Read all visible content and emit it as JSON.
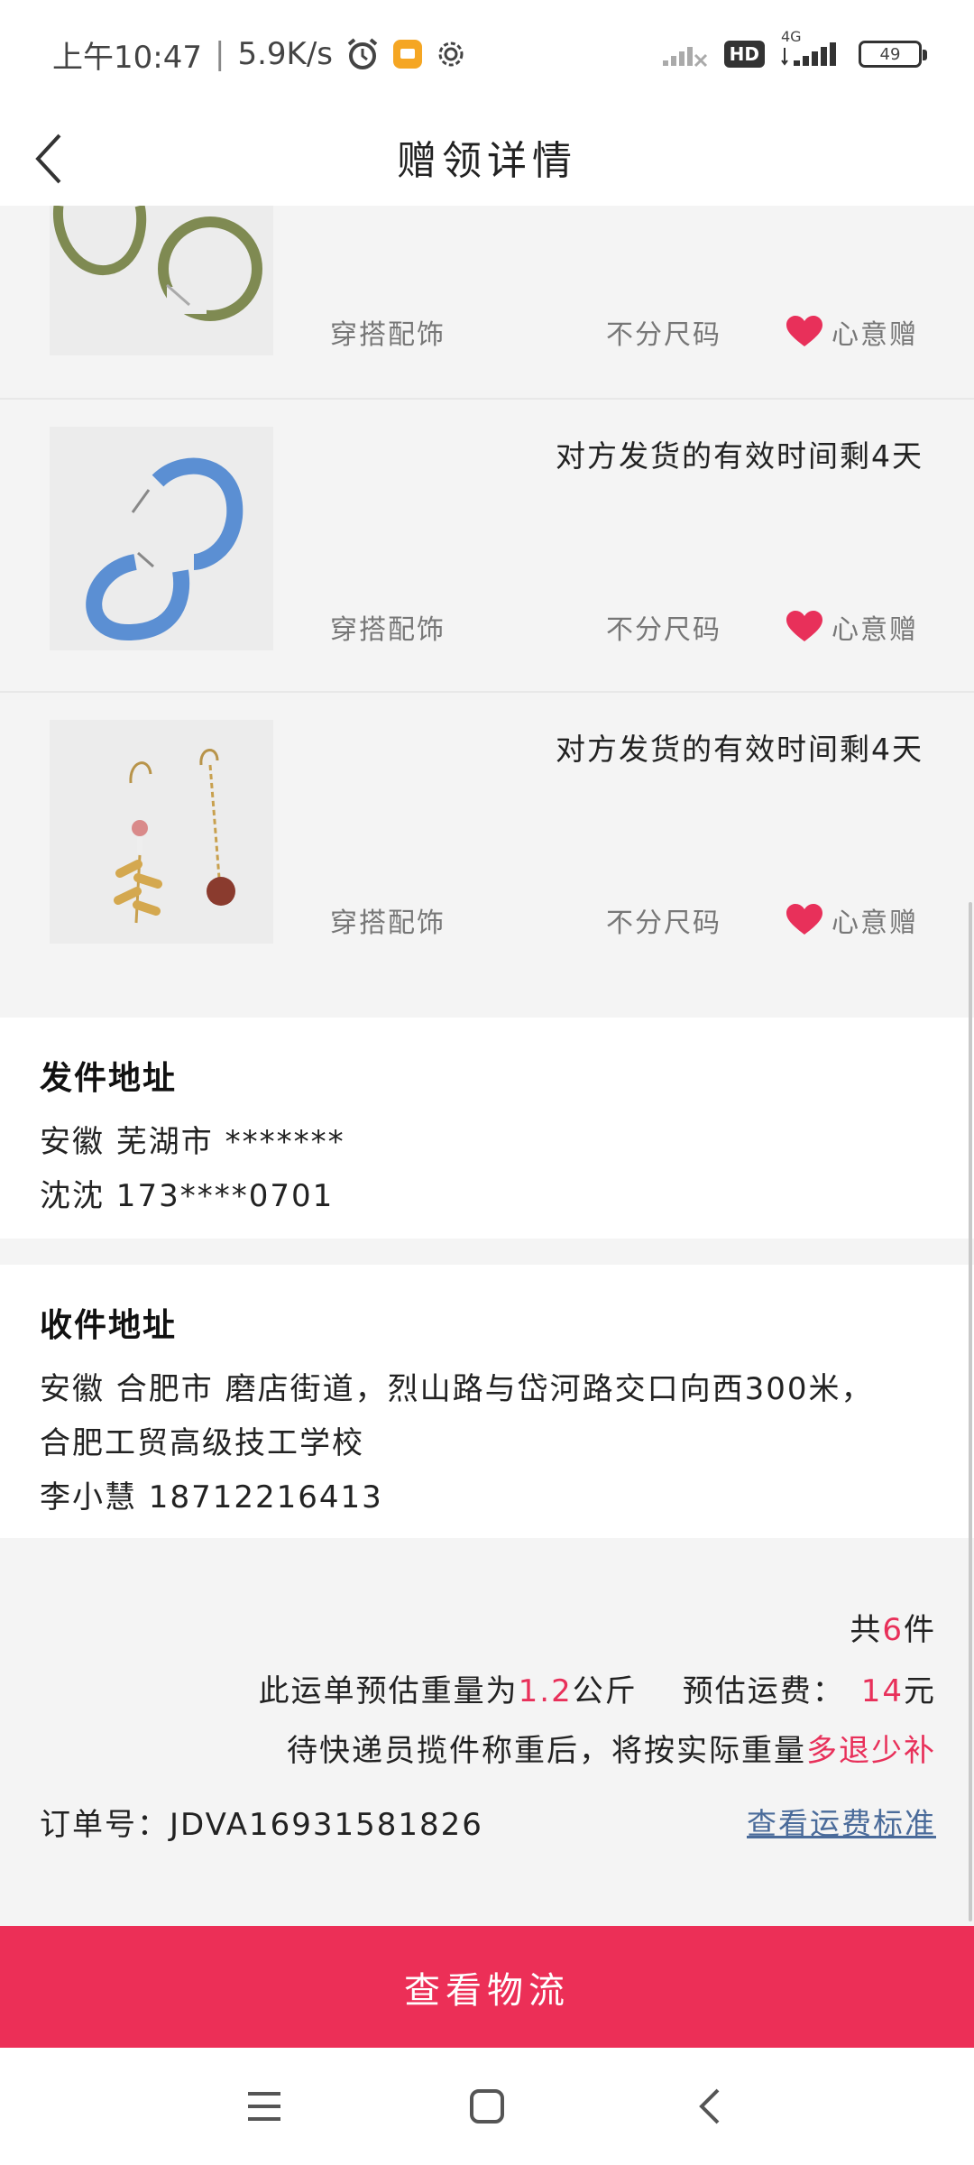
{
  "status_bar": {
    "time": "上午10:47",
    "speed": "5.9K/s",
    "hd": "HD",
    "network": "4G",
    "battery": "49"
  },
  "header": {
    "title": "赠领详情"
  },
  "items": [
    {
      "deadline": "",
      "category": "穿搭配饰",
      "size": "不分尺码",
      "type": "心意赠",
      "photo": "green-hoop-earrings"
    },
    {
      "deadline": "对方发货的有效时间剩4天",
      "category": "穿搭配饰",
      "size": "不分尺码",
      "type": "心意赠",
      "photo": "blue-hoop-earrings"
    },
    {
      "deadline": "对方发货的有效时间剩4天",
      "category": "穿搭配饰",
      "size": "不分尺码",
      "type": "心意赠",
      "photo": "leaf-bead-drop-earrings"
    }
  ],
  "sender": {
    "title": "发件地址",
    "address": "安徽 芜湖市 *******",
    "contact": "沈沈 173****0701"
  },
  "receiver": {
    "title": "收件地址",
    "address_line1": "安徽 合肥市 磨店街道，烈山路与岱河路交口向西300米，",
    "address_line2": "合肥工贸高级技工学校",
    "contact": "李小慧 18712216413"
  },
  "summary": {
    "count_prefix": "共",
    "count": "6",
    "count_suffix": "件",
    "weight_prefix": "此运单预估重量为",
    "weight": "1.2",
    "weight_unit": "公斤",
    "fee_prefix": "预估运费：",
    "fee": "14",
    "fee_unit": "元",
    "note_prefix": "待快递员揽件称重后，将按实际重量",
    "note_highlight": "多退少补",
    "order_label": "订单号：",
    "order_no": "JDVA16931581826",
    "fee_standard_link": "查看运费标准"
  },
  "actions": {
    "logistics": "查看物流"
  },
  "colors": {
    "accent": "#ec2f57",
    "heart": "#e8305a",
    "link": "#4a6b9a"
  }
}
